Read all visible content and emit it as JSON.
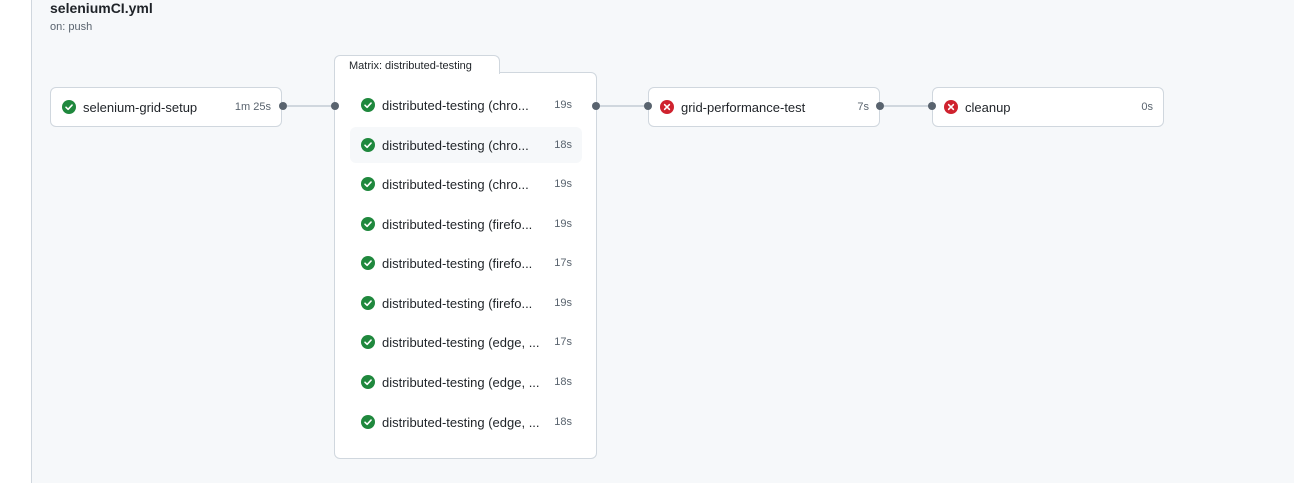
{
  "workflow": {
    "title": "seleniumCI.yml",
    "trigger": "on: push"
  },
  "colors": {
    "success": "#1f883d",
    "failure": "#cf222e"
  },
  "jobs": {
    "setup": {
      "name": "selenium-grid-setup",
      "duration": "1m 25s",
      "status": "success"
    },
    "matrix": {
      "label": "Matrix: distributed-testing",
      "items": [
        {
          "name": "distributed-testing (chro...",
          "duration": "19s",
          "status": "success"
        },
        {
          "name": "distributed-testing (chro...",
          "duration": "18s",
          "status": "success"
        },
        {
          "name": "distributed-testing (chro...",
          "duration": "19s",
          "status": "success"
        },
        {
          "name": "distributed-testing (firefo...",
          "duration": "19s",
          "status": "success"
        },
        {
          "name": "distributed-testing (firefo...",
          "duration": "17s",
          "status": "success"
        },
        {
          "name": "distributed-testing (firefo...",
          "duration": "19s",
          "status": "success"
        },
        {
          "name": "distributed-testing (edge, ...",
          "duration": "17s",
          "status": "success"
        },
        {
          "name": "distributed-testing (edge, ...",
          "duration": "18s",
          "status": "success"
        },
        {
          "name": "distributed-testing (edge, ...",
          "duration": "18s",
          "status": "success"
        }
      ]
    },
    "perf": {
      "name": "grid-performance-test",
      "duration": "7s",
      "status": "failure"
    },
    "cleanup": {
      "name": "cleanup",
      "duration": "0s",
      "status": "failure"
    }
  }
}
